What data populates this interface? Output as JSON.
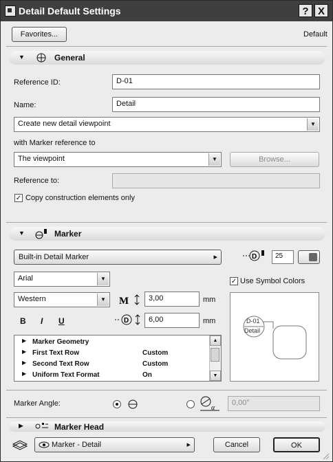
{
  "window": {
    "title": "Detail Default Settings",
    "help_label": "?",
    "close_label": "X"
  },
  "top": {
    "favorites_label": "Favorites...",
    "default_label": "Default"
  },
  "general": {
    "title": "General",
    "reference_id_label": "Reference ID:",
    "reference_id_value": "D-01",
    "name_label": "Name:",
    "name_value": "Detail",
    "create_mode": "Create new detail viewpoint",
    "marker_ref_label": "with Marker reference to",
    "marker_ref_value": "The viewpoint",
    "browse_label": "Browse...",
    "reference_to_label": "Reference to:",
    "reference_to_value": "",
    "copy_elements_label": "Copy construction elements only",
    "copy_elements_checked": true
  },
  "marker": {
    "title": "Marker",
    "marker_type": "Built-in Detail Marker",
    "size_value": "25",
    "font": "Arial",
    "script": "Western",
    "use_symbol_colors_label": "Use Symbol Colors",
    "use_symbol_colors_checked": true,
    "text_height_value": "3,00",
    "text_height_unit": "mm",
    "marker_size_value": "6,00",
    "marker_size_unit": "mm",
    "bold_label": "B",
    "italic_label": "I",
    "underline_label": "U",
    "tree": [
      {
        "name": "Marker Geometry",
        "value": ""
      },
      {
        "name": "First Text Row",
        "value": "Custom"
      },
      {
        "name": "Second Text Row",
        "value": "Custom"
      },
      {
        "name": "Uniform Text Format",
        "value": "On"
      }
    ],
    "preview_line1": "D-01",
    "preview_line2": "Detail",
    "angle_label": "Marker Angle:",
    "angle_value": "0,00°"
  },
  "marker_head": {
    "title": "Marker Head"
  },
  "footer": {
    "layer": "Marker - Detail",
    "cancel_label": "Cancel",
    "ok_label": "OK"
  }
}
